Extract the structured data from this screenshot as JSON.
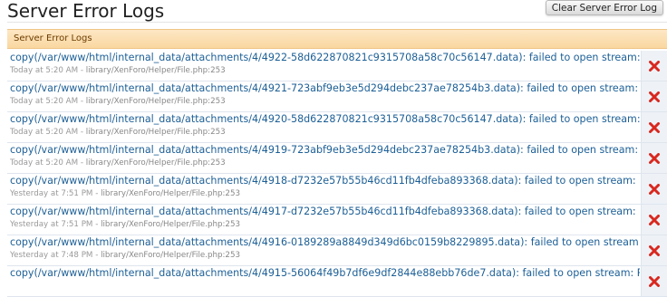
{
  "page": {
    "title": "Server Error Logs",
    "clear_button": "Clear Server Error Log"
  },
  "section": {
    "header": "Server Error Logs"
  },
  "colors": {
    "link": "#1c5f96",
    "header_bg": "#fad7a0",
    "delete_icon": "#d9281f"
  },
  "icons": {
    "delete": "delete-x-icon"
  },
  "logs": [
    {
      "message": "copy(/var/www/html/internal_data/attachments/4/4922-58d622870821c9315708a58c70c56147.data): failed to open stream: Permission denied",
      "time": "Today at 5:20 AM",
      "file": "library/XenForo/Helper/File.php:253"
    },
    {
      "message": "copy(/var/www/html/internal_data/attachments/4/4921-723abf9eb3e5d294debc237ae78254b3.data): failed to open stream: Permission denied",
      "time": "Today at 5:20 AM",
      "file": "library/XenForo/Helper/File.php:253"
    },
    {
      "message": "copy(/var/www/html/internal_data/attachments/4/4920-58d622870821c9315708a58c70c56147.data): failed to open stream: Permission denied",
      "time": "Today at 5:20 AM",
      "file": "library/XenForo/Helper/File.php:253"
    },
    {
      "message": "copy(/var/www/html/internal_data/attachments/4/4919-723abf9eb3e5d294debc237ae78254b3.data): failed to open stream: Permission denied",
      "time": "Today at 5:20 AM",
      "file": "library/XenForo/Helper/File.php:253"
    },
    {
      "message": "copy(/var/www/html/internal_data/attachments/4/4918-d7232e57b55b46cd11fb4dfeba893368.data): failed to open stream: Permission denied",
      "time": "Yesterday at 7:51 PM",
      "file": "library/XenForo/Helper/File.php:253"
    },
    {
      "message": "copy(/var/www/html/internal_data/attachments/4/4917-d7232e57b55b46cd11fb4dfeba893368.data): failed to open stream: Permission denied",
      "time": "Yesterday at 7:51 PM",
      "file": "library/XenForo/Helper/File.php:253"
    },
    {
      "message": "copy(/var/www/html/internal_data/attachments/4/4916-0189289a8849d349d6bc0159b8229895.data): failed to open stream: Permission denied",
      "time": "Yesterday at 7:48 PM",
      "file": "library/XenForo/Helper/File.php:253"
    },
    {
      "message": "copy(/var/www/html/internal_data/attachments/4/4915-56064f49b7df6e9df2844e88ebb76de7.data): failed to open stream: Permission denied",
      "time": "",
      "file": ""
    }
  ]
}
